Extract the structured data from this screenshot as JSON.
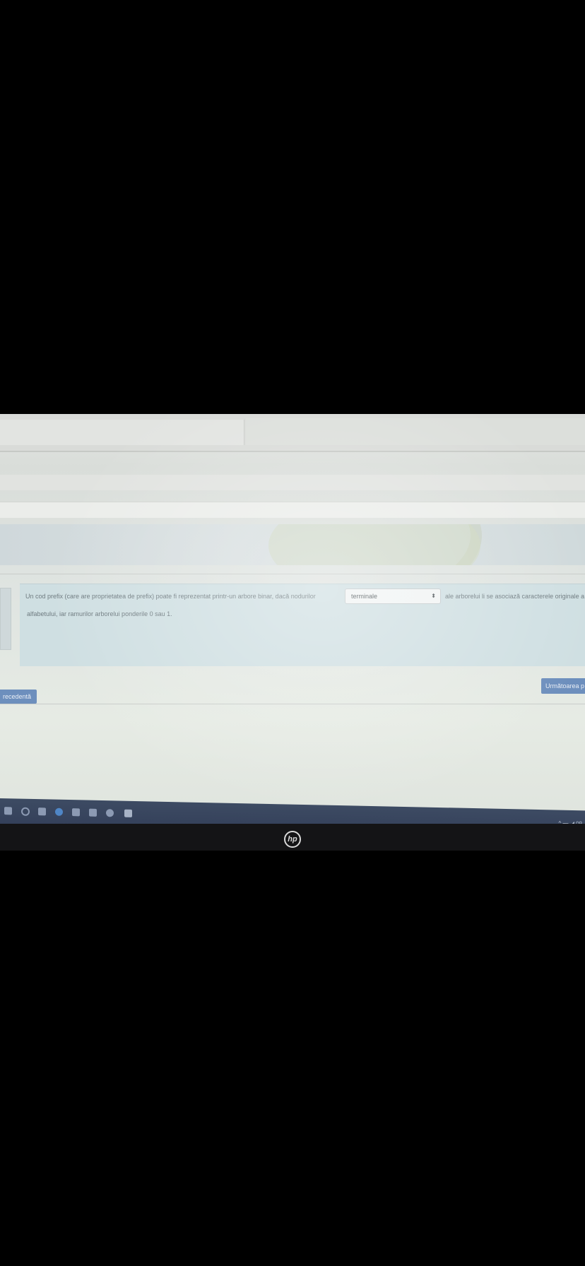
{
  "question": {
    "text_before": "Un cod prefix (care are proprietatea de prefix) poate fi reprezentat printr-un arbore binar, dacă nodurilor",
    "text_after": "ale arborelui li se asociază caracterele originale a",
    "text_line2": "alfabetului, iar ramurilor arborelui ponderile 0 sau 1."
  },
  "answer_select": {
    "value": "terminale",
    "arrow": "⬍"
  },
  "navigation": {
    "prev_label": "recedentă",
    "next_label": "Următoarea p"
  },
  "taskbar": {
    "tray_text": "^ ▬ ◢ 09"
  },
  "laptop": {
    "brand": "hp"
  }
}
